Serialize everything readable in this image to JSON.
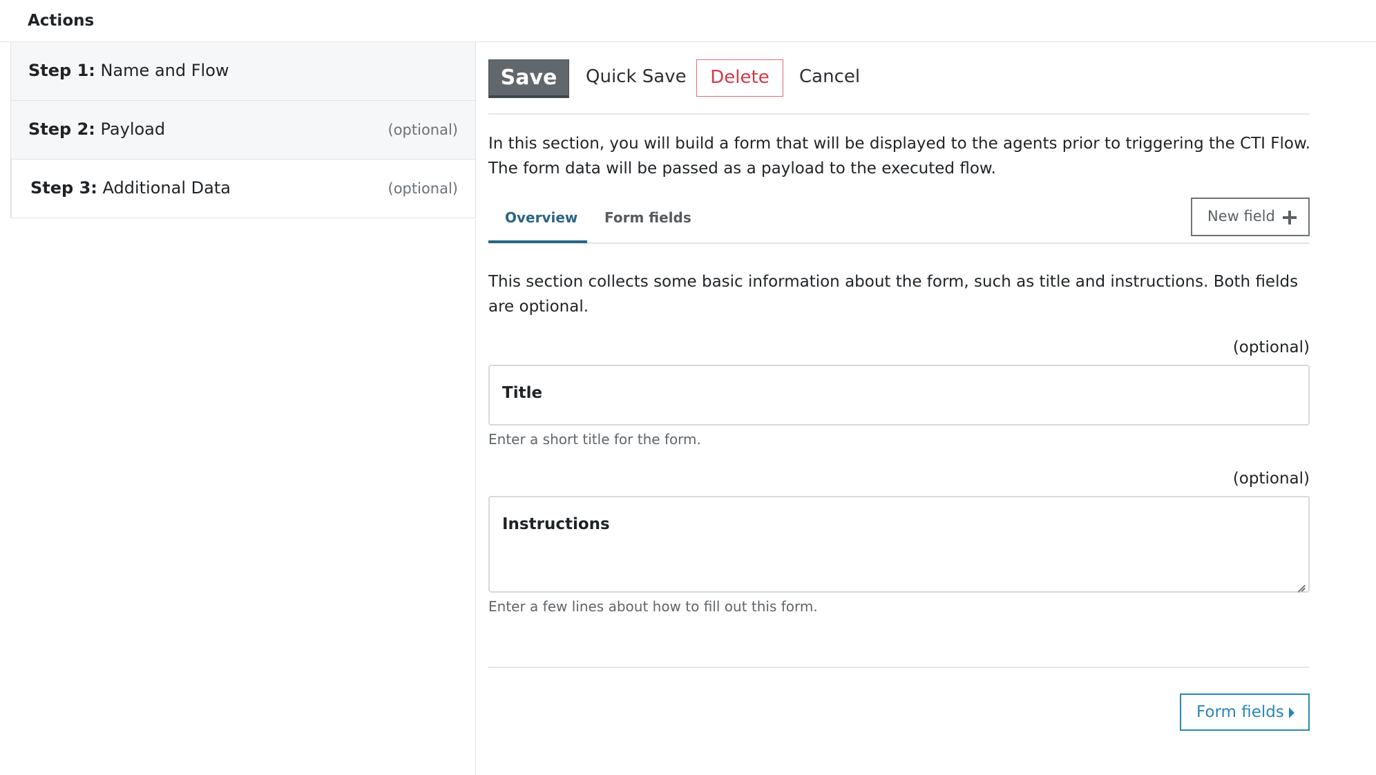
{
  "header": {
    "title": "Actions"
  },
  "steps": [
    {
      "number": "Step 1:",
      "label": "Name and Flow",
      "optional": ""
    },
    {
      "number": "Step 2:",
      "label": "Payload",
      "optional": "(optional)"
    },
    {
      "number": "Step 3:",
      "label": "Additional Data",
      "optional": "(optional)"
    }
  ],
  "toolbar": {
    "save_label": "Save",
    "quick_save_label": "Quick Save",
    "delete_label": "Delete",
    "cancel_label": "Cancel"
  },
  "intro_text": "In this section, you will build a form that will be displayed to the agents prior to triggering the CTI Flow. The form data will be passed as a payload to the executed flow.",
  "tabs": [
    {
      "label": "Overview",
      "active": true
    },
    {
      "label": "Form fields",
      "active": false
    }
  ],
  "new_field_label": "New field",
  "overview": {
    "description": "This section collects some basic information about the form, such as title and instructions. Both fields are optional.",
    "fields": [
      {
        "label": "Title",
        "optional": "(optional)",
        "help": "Enter a short title for the form.",
        "value": ""
      },
      {
        "label": "Instructions",
        "optional": "(optional)",
        "help": "Enter a few lines about how to fill out this form.",
        "value": ""
      }
    ]
  },
  "next_button_label": "Form fields",
  "icons": {
    "new_field": "plus-icon",
    "next": "caret-right-icon",
    "resize": "resize-handle-icon"
  },
  "colors": {
    "accent": "#2a6585",
    "link": "#2a86b5",
    "danger": "#d73844",
    "primary_button": "#60676d"
  }
}
